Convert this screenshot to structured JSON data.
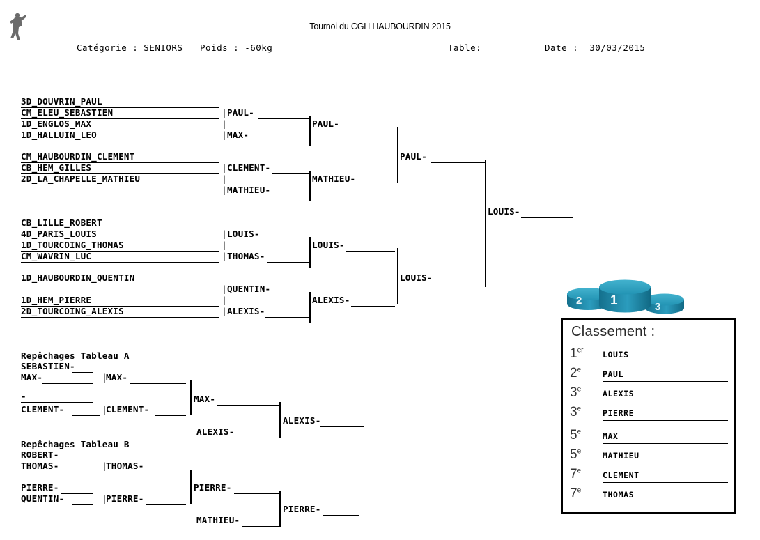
{
  "header": {
    "logo_icon": "judoka-figure-icon",
    "title": "Tournoi du CGH HAUBOURDIN 2015",
    "categorie": "Catégorie : SENIORS",
    "poids": "Poids : -60kg",
    "table": "Table:",
    "date": "Date :  30/03/2015"
  },
  "main_bracket": {
    "round1": [
      {
        "label": "3D_DOUVRIN_PAUL"
      },
      {
        "label": "CM_ELEU_SEBASTIEN"
      },
      {
        "label": "1D_ENGLOS_MAX"
      },
      {
        "label": "1D_HALLUIN_LEO"
      },
      {
        "label": "CM_HAUBOURDIN_CLEMENT"
      },
      {
        "label": "CB_HEM_GILLES"
      },
      {
        "label": "2D_LA_CHAPELLE_MATHIEU"
      },
      {
        "label": ""
      },
      {
        "label": "CB_LILLE_ROBERT"
      },
      {
        "label": "4D_PARIS_LOUIS"
      },
      {
        "label": "1D_TOURCOING_THOMAS"
      },
      {
        "label": "CM_WAVRIN_LUC"
      },
      {
        "label": "1D_HAUBOURDIN_QUENTIN"
      },
      {
        "label": ""
      },
      {
        "label": "1D_HEM_PIERRE"
      },
      {
        "label": "2D_TOURCOING_ALEXIS"
      }
    ],
    "round2": [
      {
        "label": "PAUL-"
      },
      {
        "label": "MAX-"
      },
      {
        "label": "CLEMENT-"
      },
      {
        "label": "MATHIEU-"
      },
      {
        "label": "LOUIS-"
      },
      {
        "label": "THOMAS-"
      },
      {
        "label": "QUENTIN-"
      },
      {
        "label": "ALEXIS-"
      }
    ],
    "quarterfinals": [
      {
        "label": "PAUL-"
      },
      {
        "label": "MATHIEU-"
      },
      {
        "label": "LOUIS-"
      },
      {
        "label": "ALEXIS-"
      }
    ],
    "semifinals": [
      {
        "label": "PAUL-"
      },
      {
        "label": "LOUIS-"
      }
    ],
    "final": {
      "label": "LOUIS-"
    }
  },
  "repechage_a": {
    "title": "Repêchages Tableau A",
    "round1": [
      {
        "label": "SEBASTIEN-"
      },
      {
        "label": "MAX-"
      },
      {
        "label": "-"
      },
      {
        "label": "CLEMENT-"
      }
    ],
    "round2": [
      {
        "label": "MAX-"
      },
      {
        "label": "CLEMENT-"
      }
    ],
    "round3": [
      {
        "label": "MAX-"
      },
      {
        "label": "ALEXIS-"
      }
    ],
    "winner": {
      "label": "ALEXIS-"
    }
  },
  "repechage_b": {
    "title": "Repêchages Tableau B",
    "round1": [
      {
        "label": "ROBERT-"
      },
      {
        "label": "THOMAS-"
      },
      {
        "label": "PIERRE-"
      },
      {
        "label": "QUENTIN-"
      }
    ],
    "round2": [
      {
        "label": "THOMAS-"
      },
      {
        "label": "PIERRE-"
      }
    ],
    "round3": [
      {
        "label": "PIERRE-"
      },
      {
        "label": "MATHIEU-"
      }
    ],
    "winner": {
      "label": "PIERRE-"
    }
  },
  "podium": {
    "icon": "podium-3d-icon",
    "first_label": "1",
    "second_label": "2",
    "third_label": "3",
    "color": "#1f8fb0",
    "color_dark": "#176f8a",
    "color_light": "#38a8c8"
  },
  "classement": {
    "title": "Classement :",
    "rows": [
      {
        "place": "1",
        "suffix": "er",
        "name": "LOUIS"
      },
      {
        "place": "2",
        "suffix": "e",
        "name": "PAUL"
      },
      {
        "place": "3",
        "suffix": "e",
        "name": "ALEXIS"
      },
      {
        "place": "3",
        "suffix": "e",
        "name": "PIERRE"
      },
      {
        "place": "5",
        "suffix": "e",
        "name": "MAX"
      },
      {
        "place": "5",
        "suffix": "e",
        "name": "MATHIEU"
      },
      {
        "place": "7",
        "suffix": "e",
        "name": "CLEMENT"
      },
      {
        "place": "7",
        "suffix": "e",
        "name": "THOMAS"
      }
    ]
  }
}
